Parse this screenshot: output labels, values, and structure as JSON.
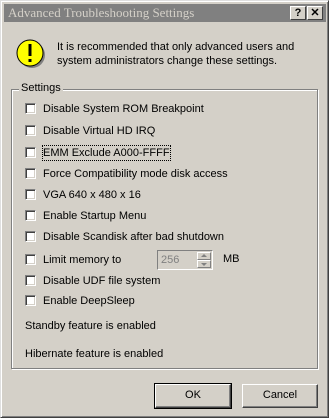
{
  "window": {
    "title": "Advanced Troubleshooting Settings",
    "help_label": "?",
    "close_label": "✕"
  },
  "warning": {
    "text": "It is recommended that only advanced users and system administrators change these settings."
  },
  "settings": {
    "label": "Settings",
    "options": [
      {
        "label": "Disable System ROM Breakpoint",
        "checked": false
      },
      {
        "label": "Disable Virtual HD IRQ",
        "checked": false
      },
      {
        "label": "EMM Exclude A000-FFFF",
        "checked": false
      },
      {
        "label": "Force Compatibility mode disk access",
        "checked": false
      },
      {
        "label": "VGA 640 x 480 x 16",
        "checked": false
      },
      {
        "label": "Enable Startup Menu",
        "checked": false
      },
      {
        "label": "Disable Scandisk after bad shutdown",
        "checked": false
      },
      {
        "label": "Limit memory to",
        "checked": false
      },
      {
        "label": "Disable UDF file system",
        "checked": false
      },
      {
        "label": "Enable DeepSleep",
        "checked": false
      }
    ],
    "memory_value": "256",
    "memory_unit": "MB"
  },
  "status": {
    "standby": "Standby feature is enabled",
    "hibernate": "Hibernate feature is enabled"
  },
  "buttons": {
    "ok": "OK",
    "cancel": "Cancel"
  },
  "icons": {
    "warning": "warning-icon"
  }
}
